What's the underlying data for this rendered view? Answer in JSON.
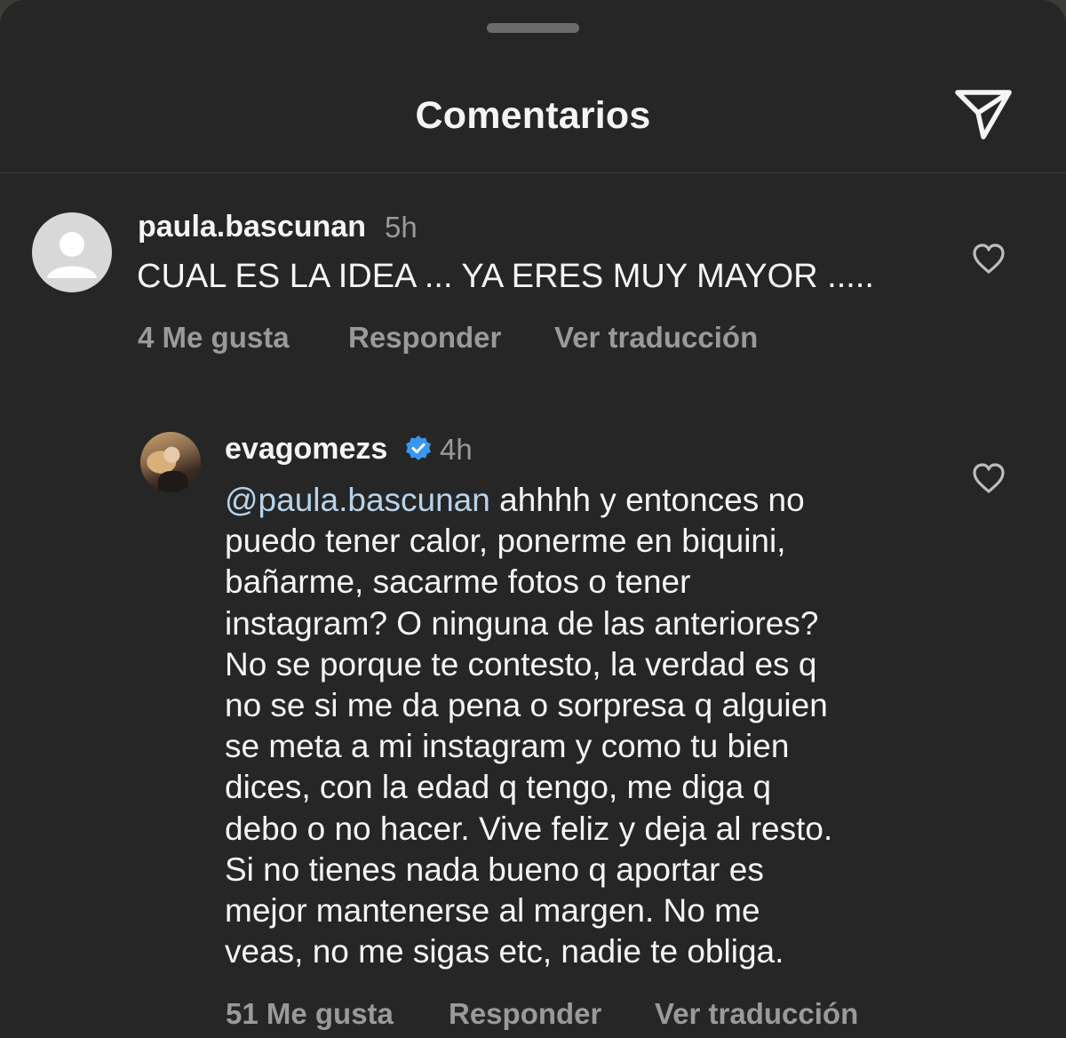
{
  "header": {
    "title": "Comentarios",
    "share_icon": "paper-plane-icon"
  },
  "comments": [
    {
      "username": "paula.bascunan",
      "time": "5h",
      "avatar_icon": "default-avatar-icon",
      "text": "CUAL ES LA IDEA ... YA ERES MUY MAYOR .....",
      "likes_label": "4 Me gusta",
      "reply_label": "Responder",
      "translate_label": "Ver traducción",
      "like_icon": "heart-outline-icon"
    }
  ],
  "reply": {
    "username": "evagomezs",
    "verified_icon": "verified-badge-icon",
    "time": "4h",
    "mention": "@paula.bascunan",
    "lines": [
      " ahhhh y entonces no",
      "puedo tener calor, ponerme en biquini,",
      "bañarme, sacarme fotos o tener",
      "instagram? O ninguna de las anteriores?",
      "No se porque te contesto, la verdad es q",
      "no se si me da pena o sorpresa q alguien",
      "se meta a mi instagram y como tu bien",
      "dices, con la edad q tengo, me diga q",
      "debo o no hacer. Vive feliz y deja al resto.",
      "Si no tienes nada bueno q aportar es",
      "mejor mantenerse al margen. No me",
      "veas, no me sigas etc, nadie te obliga."
    ],
    "likes_label": "51 Me gusta",
    "reply_label": "Responder",
    "translate_label": "Ver traducción",
    "like_icon": "heart-outline-icon"
  },
  "colors": {
    "background": "#262626",
    "text": "#f5f5f5",
    "secondary_text": "#9a9a9a",
    "mention": "#b8d3ea",
    "verified": "#3797f0"
  }
}
